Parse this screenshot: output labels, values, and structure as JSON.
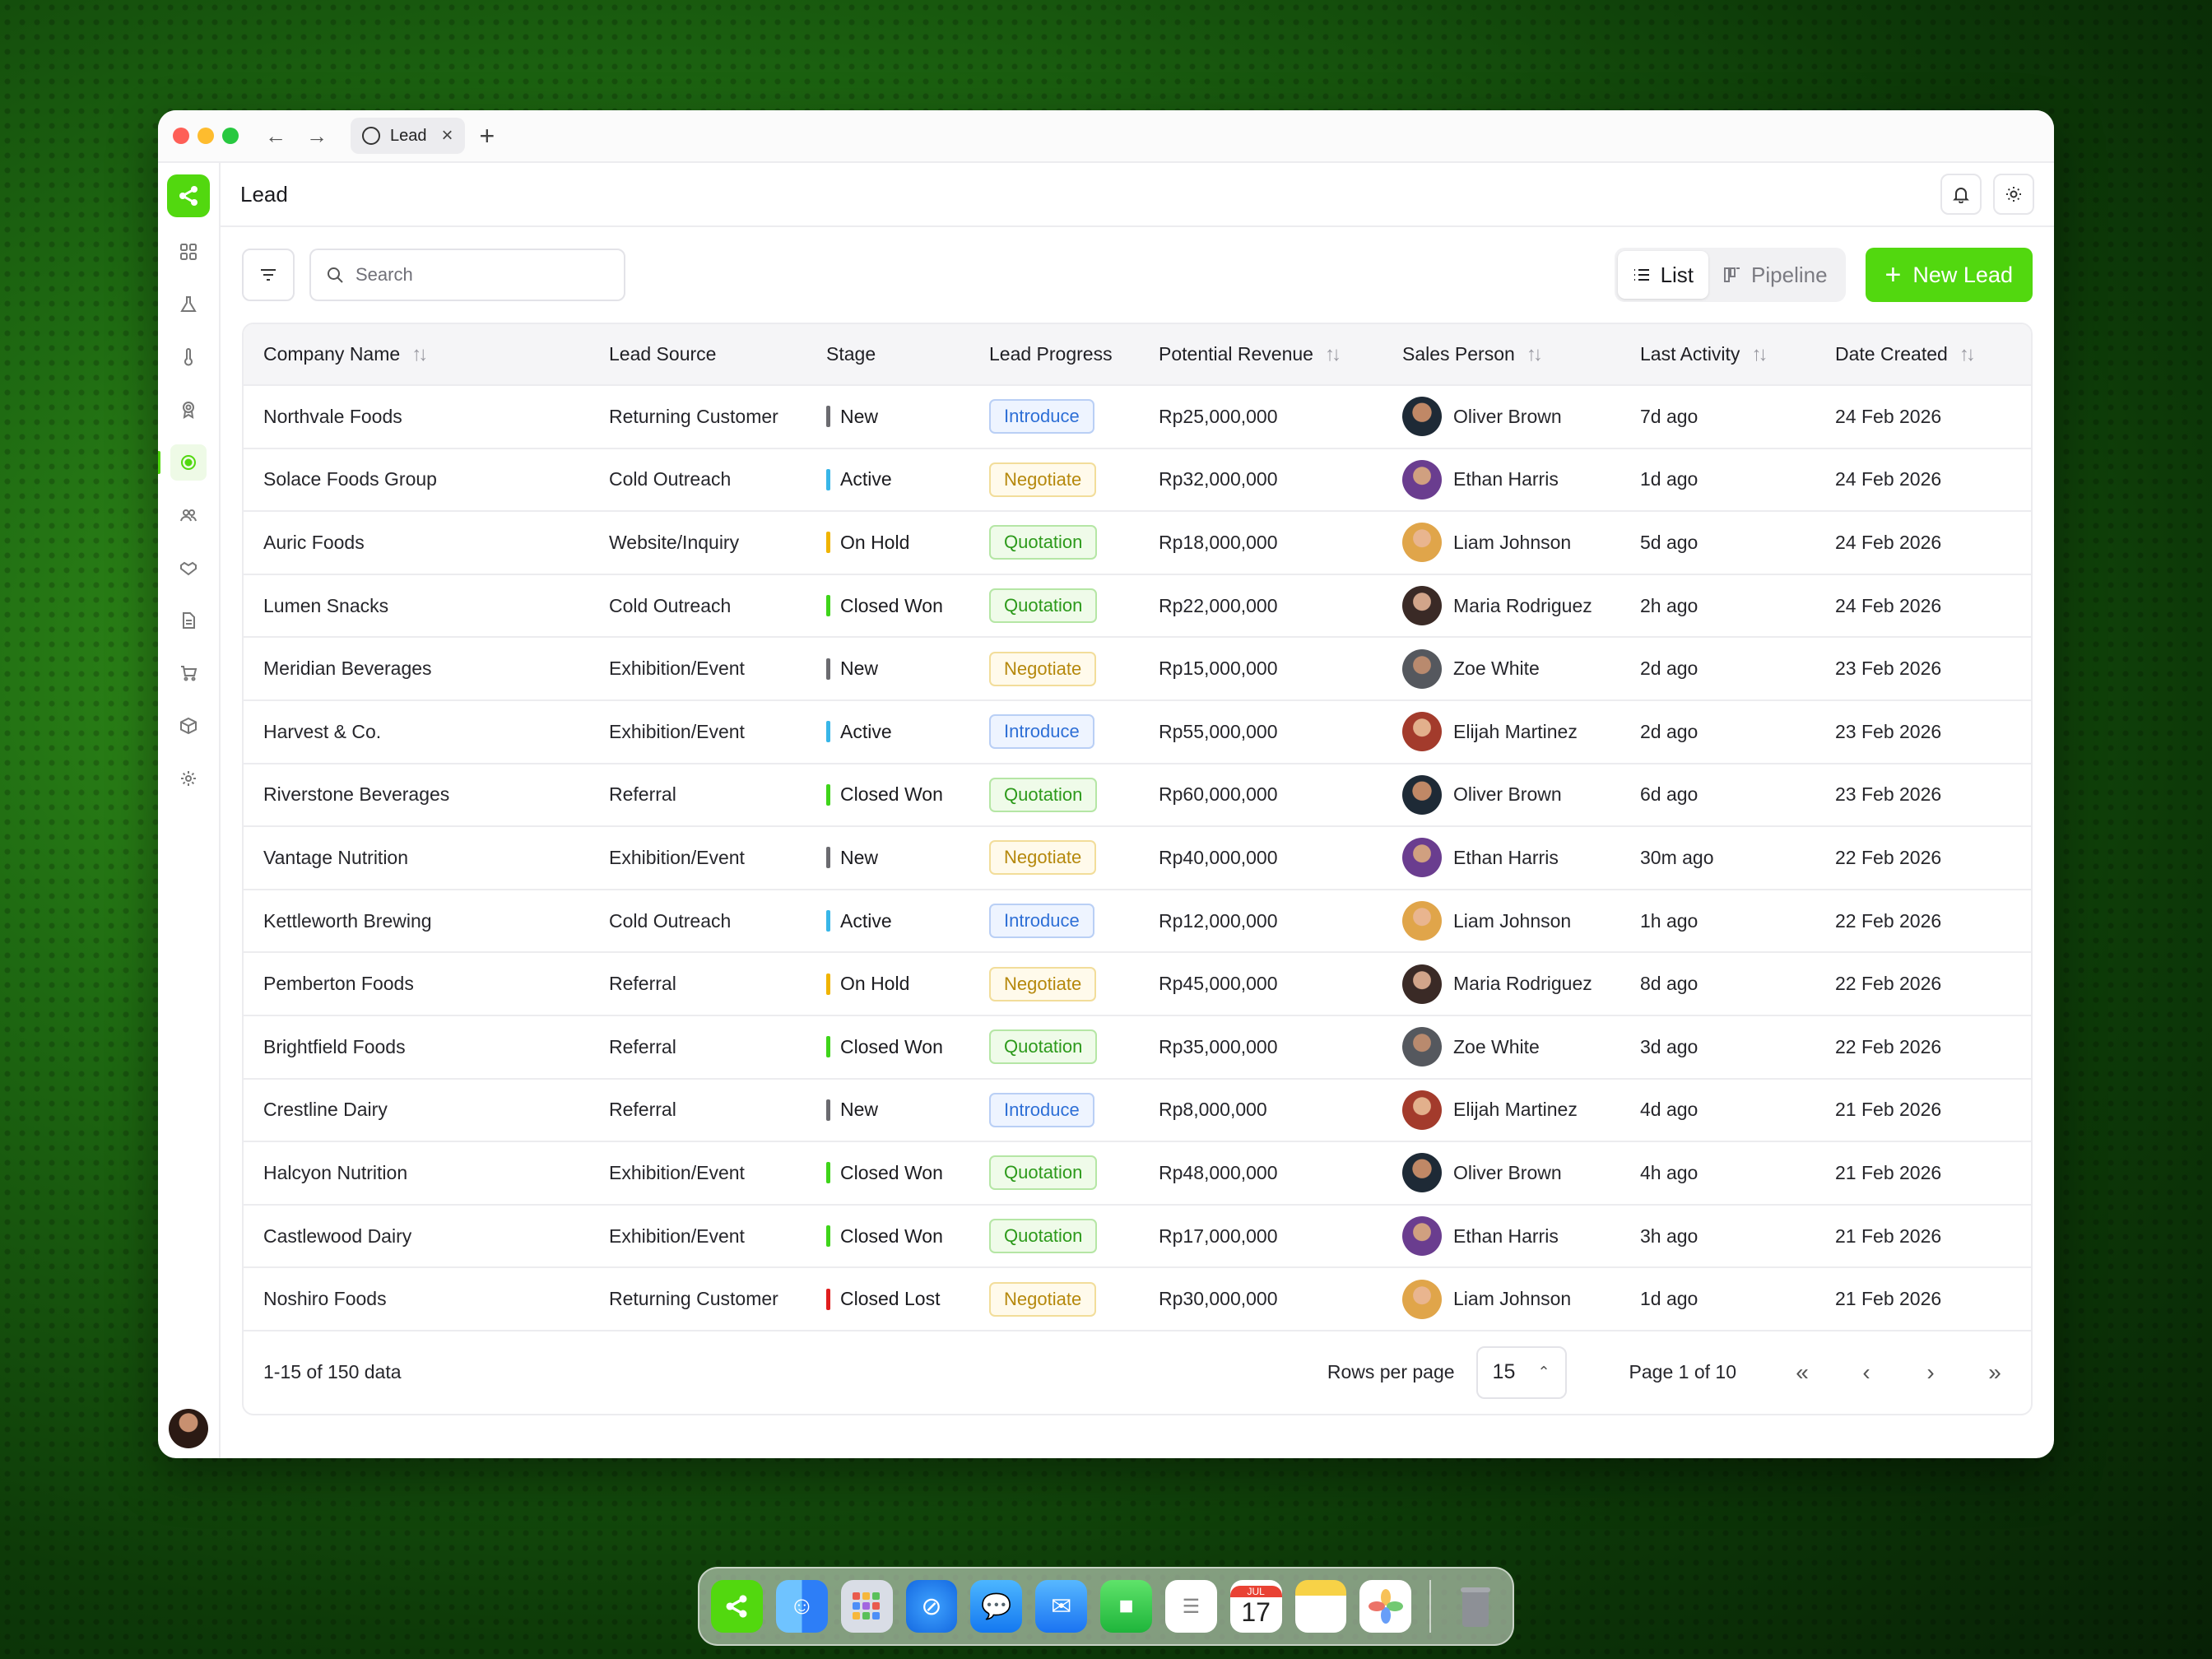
{
  "browser": {
    "tab_title": "Lead",
    "new_tab": "+",
    "back": "←",
    "forward": "→"
  },
  "header": {
    "title": "Lead"
  },
  "sidebar": {
    "icons": [
      "dashboard-icon",
      "flask-icon",
      "thermometer-icon",
      "award-icon",
      "lead-icon",
      "users-icon",
      "handshake-icon",
      "document-icon",
      "cart-icon",
      "box-icon",
      "gear-icon"
    ],
    "active_index": 4
  },
  "toolbar": {
    "search_placeholder": "Search",
    "view_list": "List",
    "view_pipeline": "Pipeline",
    "new_lead": "New Lead"
  },
  "colors": {
    "accent": "#52d80f",
    "stage_new": "#6b6b70",
    "stage_active": "#38b6e8",
    "stage_onhold": "#f0b400",
    "stage_closedwon": "#3fd41a",
    "stage_closedlost": "#e01e1e"
  },
  "table": {
    "columns": [
      "Company Name",
      "Lead Source",
      "Stage",
      "Lead Progress",
      "Potential Revenue",
      "Sales Person",
      "Last Activity",
      "Date Created"
    ],
    "rows": [
      {
        "company": "Northvale Foods",
        "source": "Returning Customer",
        "stage": "New",
        "progress": "Introduce",
        "revenue": "Rp25,000,000",
        "person": "Oliver Brown",
        "activity": "7d ago",
        "created": "24 Feb 2026"
      },
      {
        "company": "Solace Foods Group",
        "source": "Cold Outreach",
        "stage": "Active",
        "progress": "Negotiate",
        "revenue": "Rp32,000,000",
        "person": "Ethan Harris",
        "activity": "1d ago",
        "created": "24 Feb 2026"
      },
      {
        "company": "Auric Foods",
        "source": "Website/Inquiry",
        "stage": "On Hold",
        "progress": "Quotation",
        "revenue": "Rp18,000,000",
        "person": "Liam Johnson",
        "activity": "5d ago",
        "created": "24 Feb 2026"
      },
      {
        "company": "Lumen Snacks",
        "source": "Cold Outreach",
        "stage": "Closed Won",
        "progress": "Quotation",
        "revenue": "Rp22,000,000",
        "person": "Maria Rodriguez",
        "activity": "2h ago",
        "created": "24 Feb 2026"
      },
      {
        "company": "Meridian Beverages",
        "source": "Exhibition/Event",
        "stage": "New",
        "progress": "Negotiate",
        "revenue": "Rp15,000,000",
        "person": "Zoe White",
        "activity": "2d ago",
        "created": "23 Feb 2026"
      },
      {
        "company": "Harvest & Co.",
        "source": "Exhibition/Event",
        "stage": "Active",
        "progress": "Introduce",
        "revenue": "Rp55,000,000",
        "person": "Elijah Martinez",
        "activity": "2d ago",
        "created": "23 Feb 2026"
      },
      {
        "company": "Riverstone Beverages",
        "source": "Referral",
        "stage": "Closed Won",
        "progress": "Quotation",
        "revenue": "Rp60,000,000",
        "person": "Oliver Brown",
        "activity": "6d ago",
        "created": "23 Feb 2026"
      },
      {
        "company": "Vantage Nutrition",
        "source": "Exhibition/Event",
        "stage": "New",
        "progress": "Negotiate",
        "revenue": "Rp40,000,000",
        "person": "Ethan Harris",
        "activity": "30m ago",
        "created": "22 Feb 2026"
      },
      {
        "company": "Kettleworth Brewing",
        "source": "Cold Outreach",
        "stage": "Active",
        "progress": "Introduce",
        "revenue": "Rp12,000,000",
        "person": "Liam Johnson",
        "activity": "1h ago",
        "created": "22 Feb 2026"
      },
      {
        "company": "Pemberton Foods",
        "source": "Referral",
        "stage": "On Hold",
        "progress": "Negotiate",
        "revenue": "Rp45,000,000",
        "person": "Maria Rodriguez",
        "activity": "8d ago",
        "created": "22 Feb 2026"
      },
      {
        "company": "Brightfield Foods",
        "source": "Referral",
        "stage": "Closed Won",
        "progress": "Quotation",
        "revenue": "Rp35,000,000",
        "person": "Zoe White",
        "activity": "3d ago",
        "created": "22 Feb 2026"
      },
      {
        "company": "Crestline Dairy",
        "source": "Referral",
        "stage": "New",
        "progress": "Introduce",
        "revenue": "Rp8,000,000",
        "person": "Elijah Martinez",
        "activity": "4d ago",
        "created": "21 Feb 2026"
      },
      {
        "company": "Halcyon Nutrition",
        "source": "Exhibition/Event",
        "stage": "Closed Won",
        "progress": "Quotation",
        "revenue": "Rp48,000,000",
        "person": "Oliver Brown",
        "activity": "4h ago",
        "created": "21 Feb 2026"
      },
      {
        "company": "Castlewood Dairy",
        "source": "Exhibition/Event",
        "stage": "Closed Won",
        "progress": "Quotation",
        "revenue": "Rp17,000,000",
        "person": "Ethan Harris",
        "activity": "3h ago",
        "created": "21 Feb 2026"
      },
      {
        "company": "Noshiro Foods",
        "source": "Returning Customer",
        "stage": "Closed Lost",
        "progress": "Negotiate",
        "revenue": "Rp30,000,000",
        "person": "Liam Johnson",
        "activity": "1d ago",
        "created": "21 Feb 2026"
      }
    ]
  },
  "footer": {
    "range": "1-15 of 150 data",
    "rows_per_page_label": "Rows per page",
    "rows_per_page_value": "15",
    "page_info": "Page 1 of 10"
  },
  "dock": {
    "apps": [
      "app-logo-icon",
      "finder-icon",
      "launchpad-icon",
      "safari-icon",
      "messages-icon",
      "mail-icon",
      "facetime-icon",
      "reminders-icon",
      "calendar-icon",
      "notes-icon",
      "photos-icon",
      "trash-icon"
    ],
    "calendar_month": "JUL",
    "calendar_day": "17"
  }
}
